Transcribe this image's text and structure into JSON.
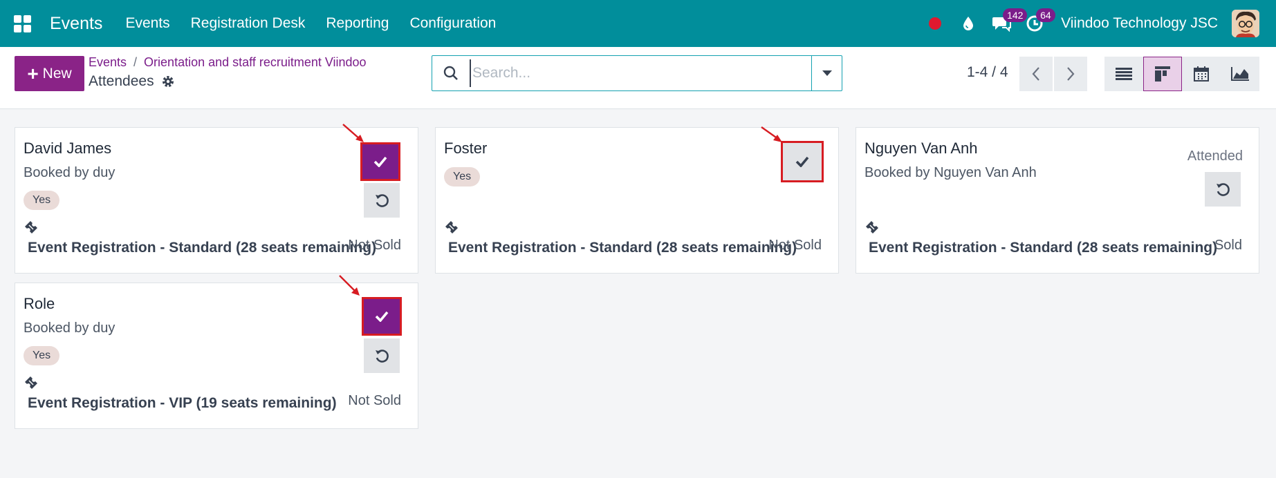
{
  "navbar": {
    "app_name": "Events",
    "menu": [
      "Events",
      "Registration Desk",
      "Reporting",
      "Configuration"
    ],
    "messages_badge": "142",
    "activities_badge": "64",
    "company": "Viindoo Technology JSC",
    "bg_color": "#018e9b"
  },
  "control": {
    "new_label": "New",
    "breadcrumb_root": "Events",
    "breadcrumb_event": "Orientation and staff recruitment Viindoo",
    "page_title": "Attendees",
    "search_placeholder": "Search...",
    "pager": "1-4 / 4",
    "views": [
      "list-view",
      "kanban-view",
      "calendar-view",
      "graph-view"
    ],
    "active_view": "kanban-view"
  },
  "cards": [
    {
      "name": "David James",
      "booked_by": "Booked by duy",
      "tag": "Yes",
      "event": "Event Registration - Standard (28 seats remaining)",
      "status": "Not Sold"
    },
    {
      "name": "Foster",
      "tag": "Yes",
      "event": "Event Registration - Standard (28 seats remaining)",
      "status": "Not Sold"
    },
    {
      "name": "Nguyen Van Anh",
      "booked_by": "Booked by Nguyen Van Anh",
      "state": "Attended",
      "event": "Event Registration - Standard (28 seats remaining)",
      "status": "Sold"
    },
    {
      "name": "Role",
      "booked_by": "Booked by duy",
      "tag": "Yes",
      "event": "Event Registration - VIP (19 seats remaining)",
      "status": "Not Sold"
    }
  ],
  "colors": {
    "primary": "#8a2387",
    "highlight": "#d71c22"
  }
}
